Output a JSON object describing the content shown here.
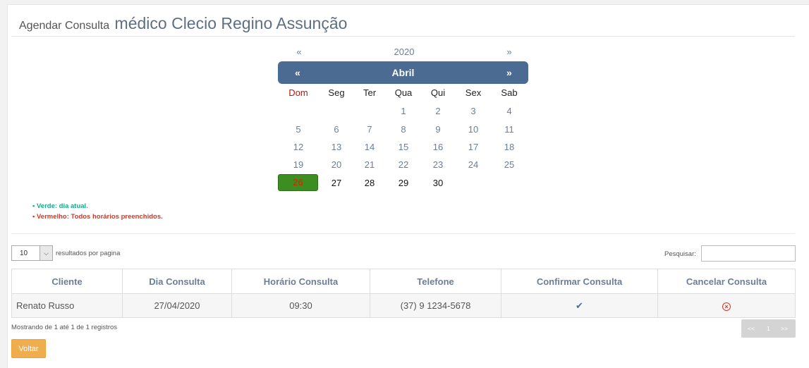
{
  "header": {
    "prefix": "Agendar Consulta",
    "doctor": "médico Clecio Regino Assunção"
  },
  "calendar": {
    "prev_year": "«",
    "year": "2020",
    "next_year": "»",
    "prev_month": "«",
    "month": "Abril",
    "next_month": "»",
    "weekdays": [
      "Dom",
      "Seg",
      "Ter",
      "Qua",
      "Qui",
      "Sex",
      "Sab"
    ],
    "weeks": [
      [
        "",
        "",
        "",
        "1",
        "2",
        "3",
        "4"
      ],
      [
        "5",
        "6",
        "7",
        "8",
        "9",
        "10",
        "11"
      ],
      [
        "12",
        "13",
        "14",
        "15",
        "16",
        "17",
        "18"
      ],
      [
        "19",
        "20",
        "21",
        "22",
        "23",
        "24",
        "25"
      ],
      [
        "26",
        "27",
        "28",
        "29",
        "30",
        "",
        ""
      ]
    ],
    "today": "26",
    "colors": {
      "bar": "#4c6b92",
      "today": "#3d8e21",
      "sunday": "#cc1100"
    }
  },
  "legend": {
    "green": "Verde: dia atual.",
    "red": "Vermelho: Todos horários preenchidos."
  },
  "controls": {
    "page_length": "10",
    "length_label": "resultados por pagina",
    "search_label": "Pesquisar:",
    "search_value": ""
  },
  "table": {
    "headers": [
      "Cliente",
      "Dia Consulta",
      "Horário Consulta",
      "Telefone",
      "Confirmar Consulta",
      "Cancelar Consulta"
    ],
    "rows": [
      {
        "cliente": "Renato Russo",
        "dia": "27/04/2020",
        "horario": "09:30",
        "telefone": "(37) 9 1234-5678",
        "confirm_icon": "check-icon",
        "cancel_icon": "x-circle-icon"
      }
    ]
  },
  "footer": {
    "info": "Mostrando de 1 até 1 de 1 registros",
    "pager": {
      "first": "<<",
      "page": "1",
      "last": ">>"
    },
    "back_label": "Voltar"
  }
}
